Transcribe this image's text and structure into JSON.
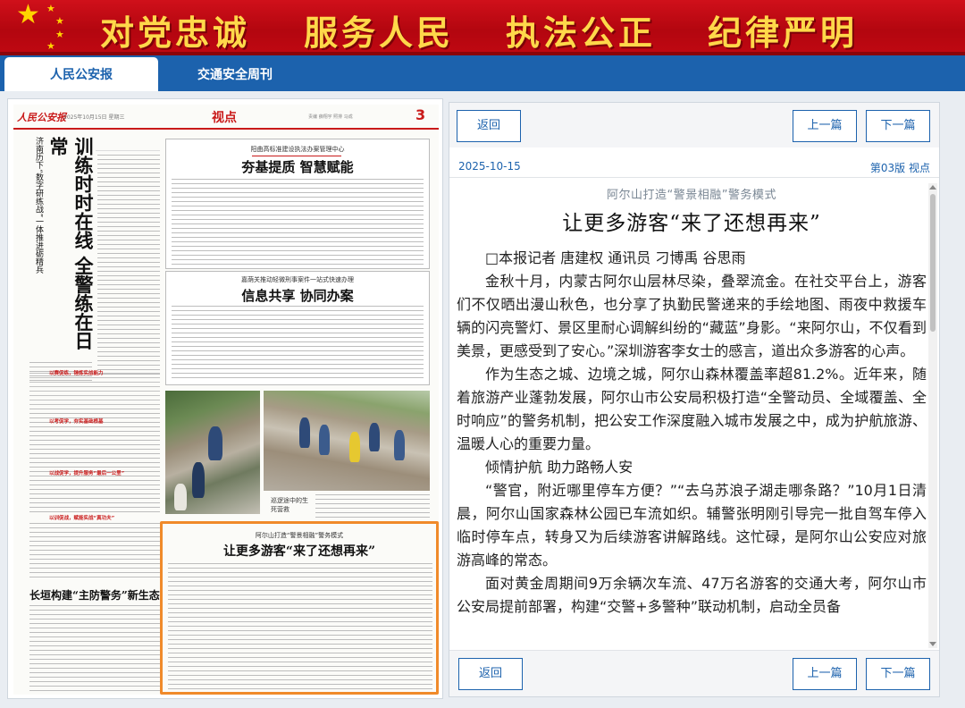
{
  "banner": {
    "slogans": [
      "对党忠诚",
      "服务人民",
      "执法公正",
      "纪律严明"
    ],
    "colors": {
      "bg": "#c00812",
      "text": "#ffd84a"
    }
  },
  "tabs": [
    {
      "label": "人民公安报",
      "active": true
    },
    {
      "label": "交通安全周刊",
      "active": false
    }
  ],
  "newspaper": {
    "logo": "人民公安报",
    "date": "2025年10月15日 星期三",
    "section": "视点",
    "tel": "责编 薛翔宇 照排 马成",
    "page_num": "3",
    "left_headline_small": "济南历下“数字研练战”一体推进砺精兵",
    "left_headline": "训练时时在线  全警练在日常",
    "top_box_sub": "阳曲高标准建设执法办案管理中心",
    "top_box_title": "夯基提质  智慧赋能",
    "mid_box_sub": "嘉荫关推动轻微刑事案件一站式快速办理",
    "mid_box_title": "信息共享  协同办案",
    "bottom_left_heading": "长垣构建“主防警务”新生态",
    "photo_caption": "巡逻途中的生死营救",
    "highlight_sub": "阿尔山打造“警景相融”警务模式",
    "highlight_title": "让更多游客“来了还想再来”",
    "small_sections": [
      "以赛促练，锤炼实战能力",
      "以考促学，夯实基础根基",
      "以战促学，提升服务“最后一公里”",
      "以训促战，赋能实战“真功夫”"
    ]
  },
  "article": {
    "top_buttons": {
      "back": "返回",
      "prev": "上一篇",
      "next": "下一篇"
    },
    "bottom_buttons": {
      "back": "返回",
      "prev": "上一篇",
      "next": "下一篇"
    },
    "date": "2025-10-15",
    "page": "第03版 视点",
    "subtitle": "阿尔山打造“警景相融”警务模式",
    "title": "让更多游客“来了还想再来”",
    "byline": "□本报记者 唐建权 通讯员 刁博禹 谷思雨",
    "paragraphs": [
      "金秋十月，内蒙古阿尔山层林尽染，叠翠流金。在社交平台上，游客们不仅晒出漫山秋色，也分享了执勤民警递来的手绘地图、雨夜中救援车辆的闪亮警灯、景区里耐心调解纠纷的“藏蓝”身影。“来阿尔山，不仅看到美景，更感受到了安心。”深圳游客李女士的感言，道出众多游客的心声。",
      "作为生态之城、边境之城，阿尔山森林覆盖率超81.2%。近年来，随着旅游产业蓬勃发展，阿尔山市公安局积极打造“全警动员、全域覆盖、全时响应”的警务机制，把公安工作深度融入城市发展之中，成为护航旅游、温暖人心的重要力量。",
      "倾情护航 助力路畅人安",
      "“警官，附近哪里停车方便？”“去乌苏浪子湖走哪条路？”10月1日清晨，阿尔山国家森林公园已车流如织。辅警张明刚引导完一批自驾车停入临时停车点，转身又为后续游客讲解路线。这忙碌，是阿尔山公安应对旅游高峰的常态。",
      "面对黄金周期间9万余辆次车流、47万名游客的交通大考，阿尔山市公安局提前部署，构建“交警+多警种”联动机制，启动全员备"
    ],
    "colors": {
      "accent": "#1c62ad",
      "highlight": "#f08a2a"
    }
  }
}
